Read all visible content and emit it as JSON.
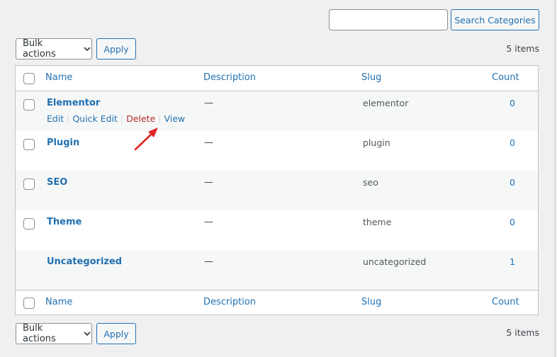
{
  "search": {
    "value": "",
    "placeholder": "",
    "button_label": "Search Categories"
  },
  "bulk_actions": {
    "selected": "Bulk actions",
    "apply_label": "Apply"
  },
  "items_count": "5 items",
  "table": {
    "columns": [
      "Name",
      "Description",
      "Slug",
      "Count"
    ],
    "rows": [
      {
        "name": "Elementor",
        "description": "—",
        "slug": "elementor",
        "count": "0",
        "has_checkbox": true
      },
      {
        "name": "Plugin",
        "description": "—",
        "slug": "plugin",
        "count": "0",
        "has_checkbox": true
      },
      {
        "name": "SEO",
        "description": "—",
        "slug": "seo",
        "count": "0",
        "has_checkbox": true
      },
      {
        "name": "Theme",
        "description": "—",
        "slug": "theme",
        "count": "0",
        "has_checkbox": true
      },
      {
        "name": "Uncategorized",
        "description": "—",
        "slug": "uncategorized",
        "count": "1",
        "has_checkbox": false
      }
    ],
    "row_actions": {
      "edit": "Edit",
      "quick_edit": "Quick Edit",
      "delete": "Delete",
      "view": "View",
      "separator": "|"
    }
  },
  "annotation": {
    "arrow_color": "#e02424",
    "points_to": "View"
  },
  "colors": {
    "link": "#2271b1",
    "delete": "#b32d2e",
    "background": "#f0f0f1",
    "alt_row": "#f6f7f7"
  }
}
